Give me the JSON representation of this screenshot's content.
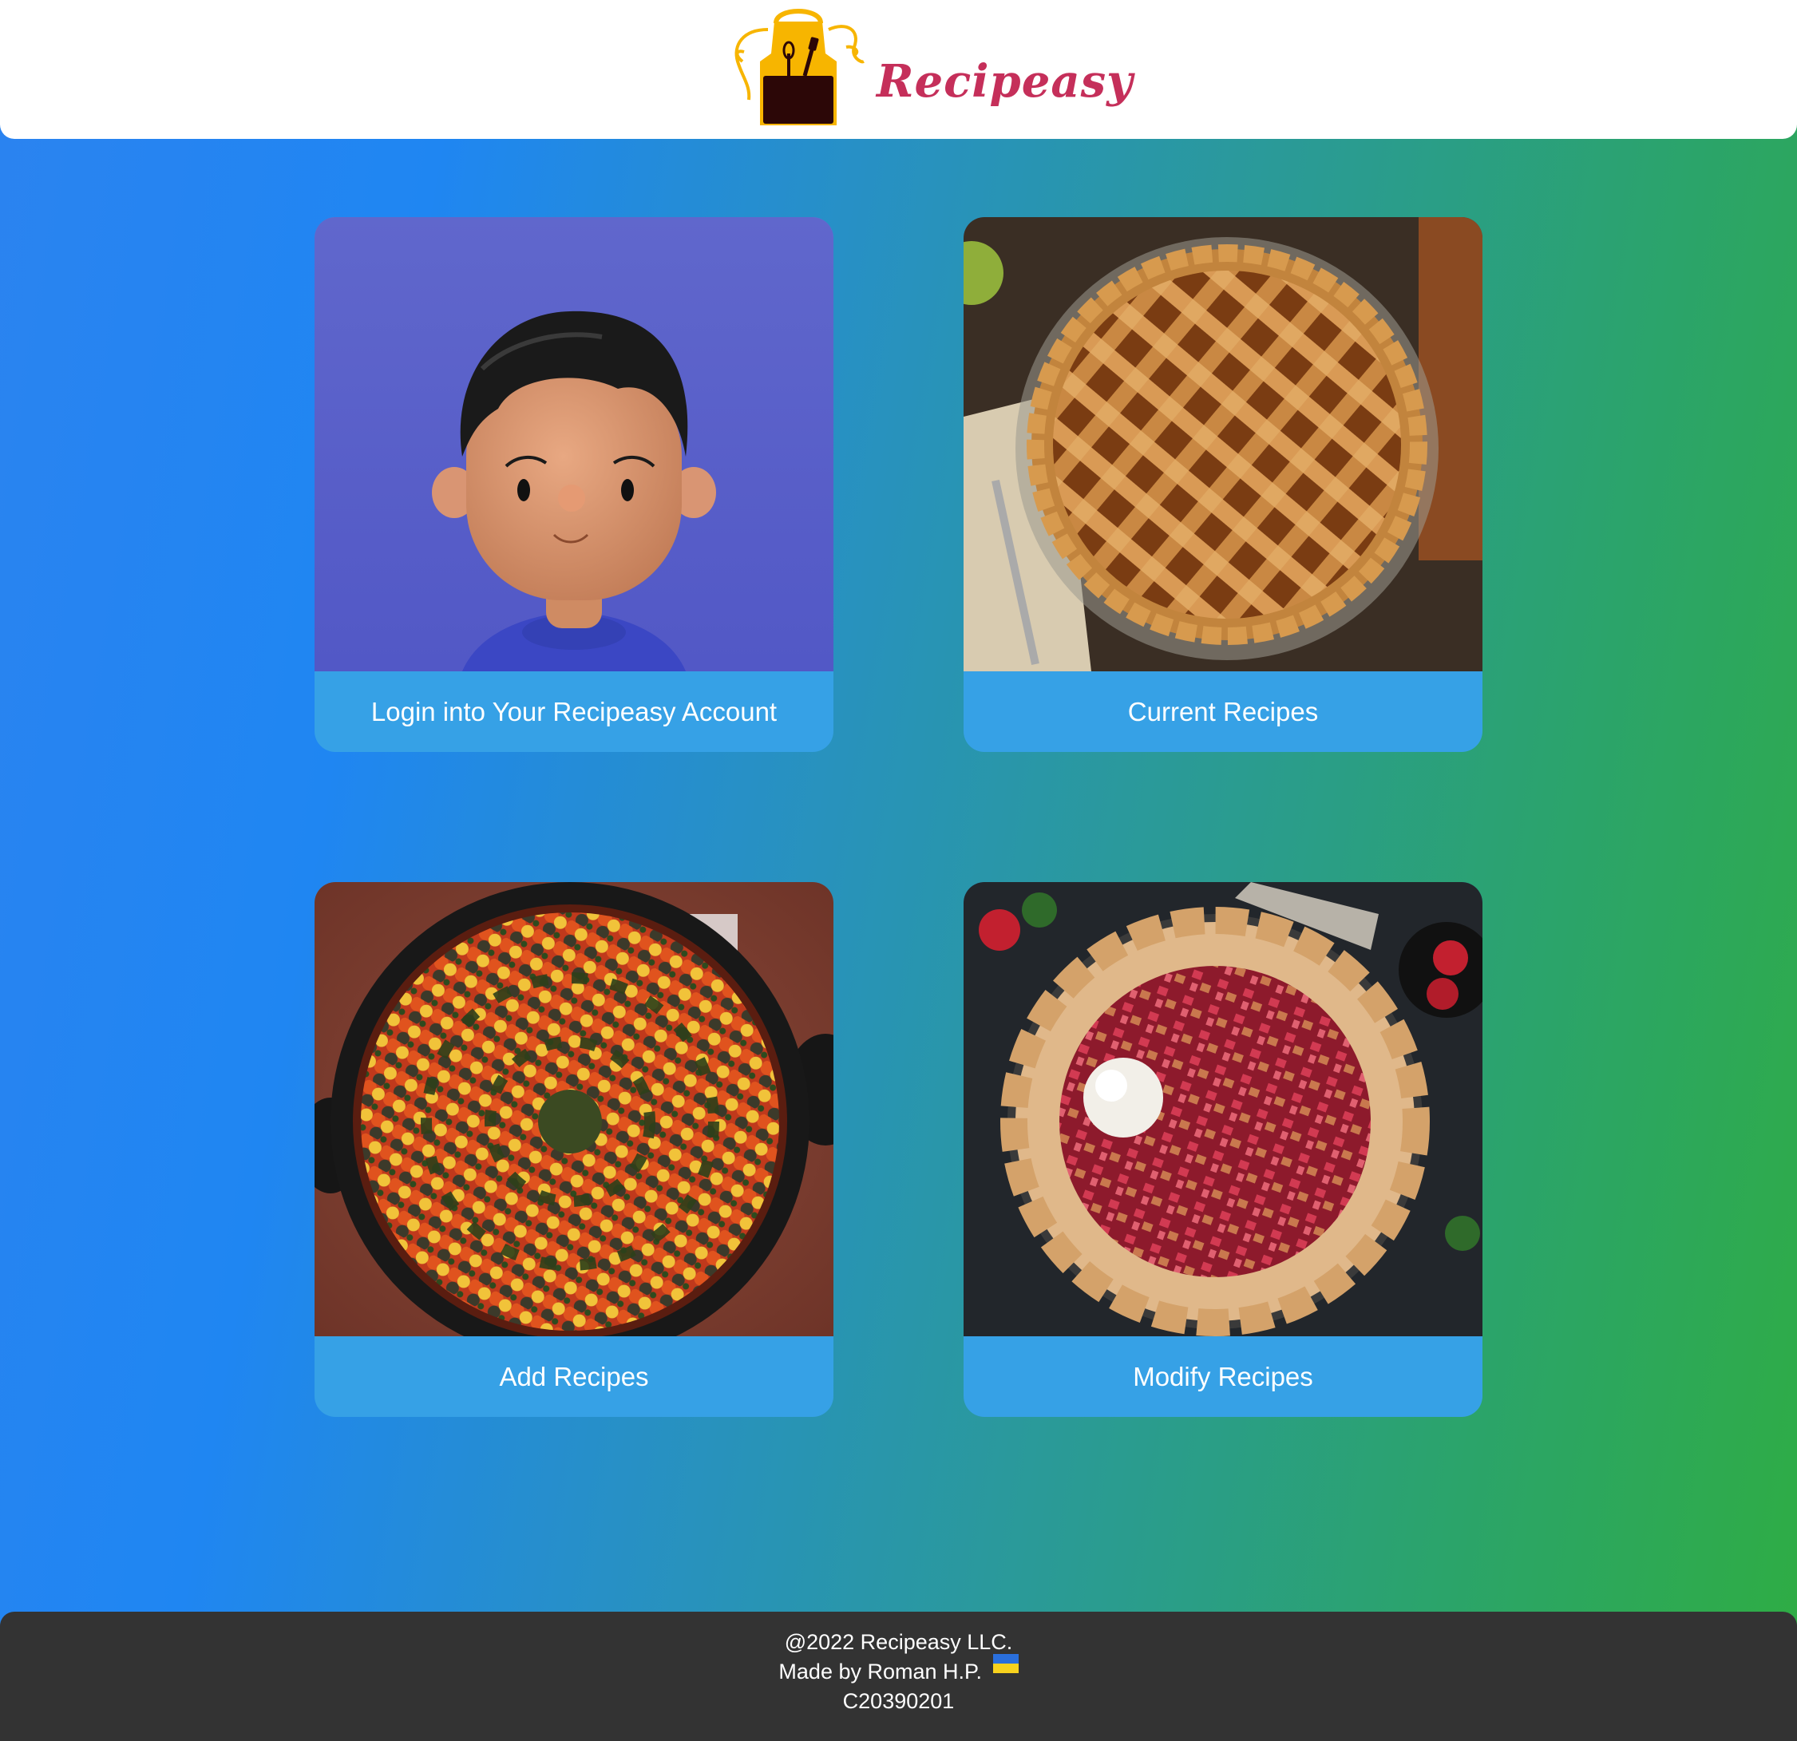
{
  "brand": {
    "name": "Recipeasy",
    "logo_icon": "apron-kitchen-tools-icon",
    "name_color": "#c52f5a",
    "apron_color": "#f7b500"
  },
  "cards": [
    {
      "id": "login",
      "label": "Login into Your Recipeasy Account",
      "image": "3d-avatar-man"
    },
    {
      "id": "current",
      "label": "Current Recipes",
      "image": "lattice-apple-pie"
    },
    {
      "id": "add",
      "label": "Add Recipes",
      "image": "ratatouille-skillet"
    },
    {
      "id": "modify",
      "label": "Modify Recipes",
      "image": "strawberry-rhubarb-galette"
    }
  ],
  "footer": {
    "copyright": "@2022 Recipeasy LLC.",
    "made_by": "Made by Roman H.P.",
    "flag": "ukraine-flag-icon",
    "code": "C20390201"
  },
  "colors": {
    "card_label_bg": "#36a1e6",
    "footer_bg": "#333333",
    "gradient_start": "#2b83f0",
    "gradient_end": "#2fad43"
  }
}
